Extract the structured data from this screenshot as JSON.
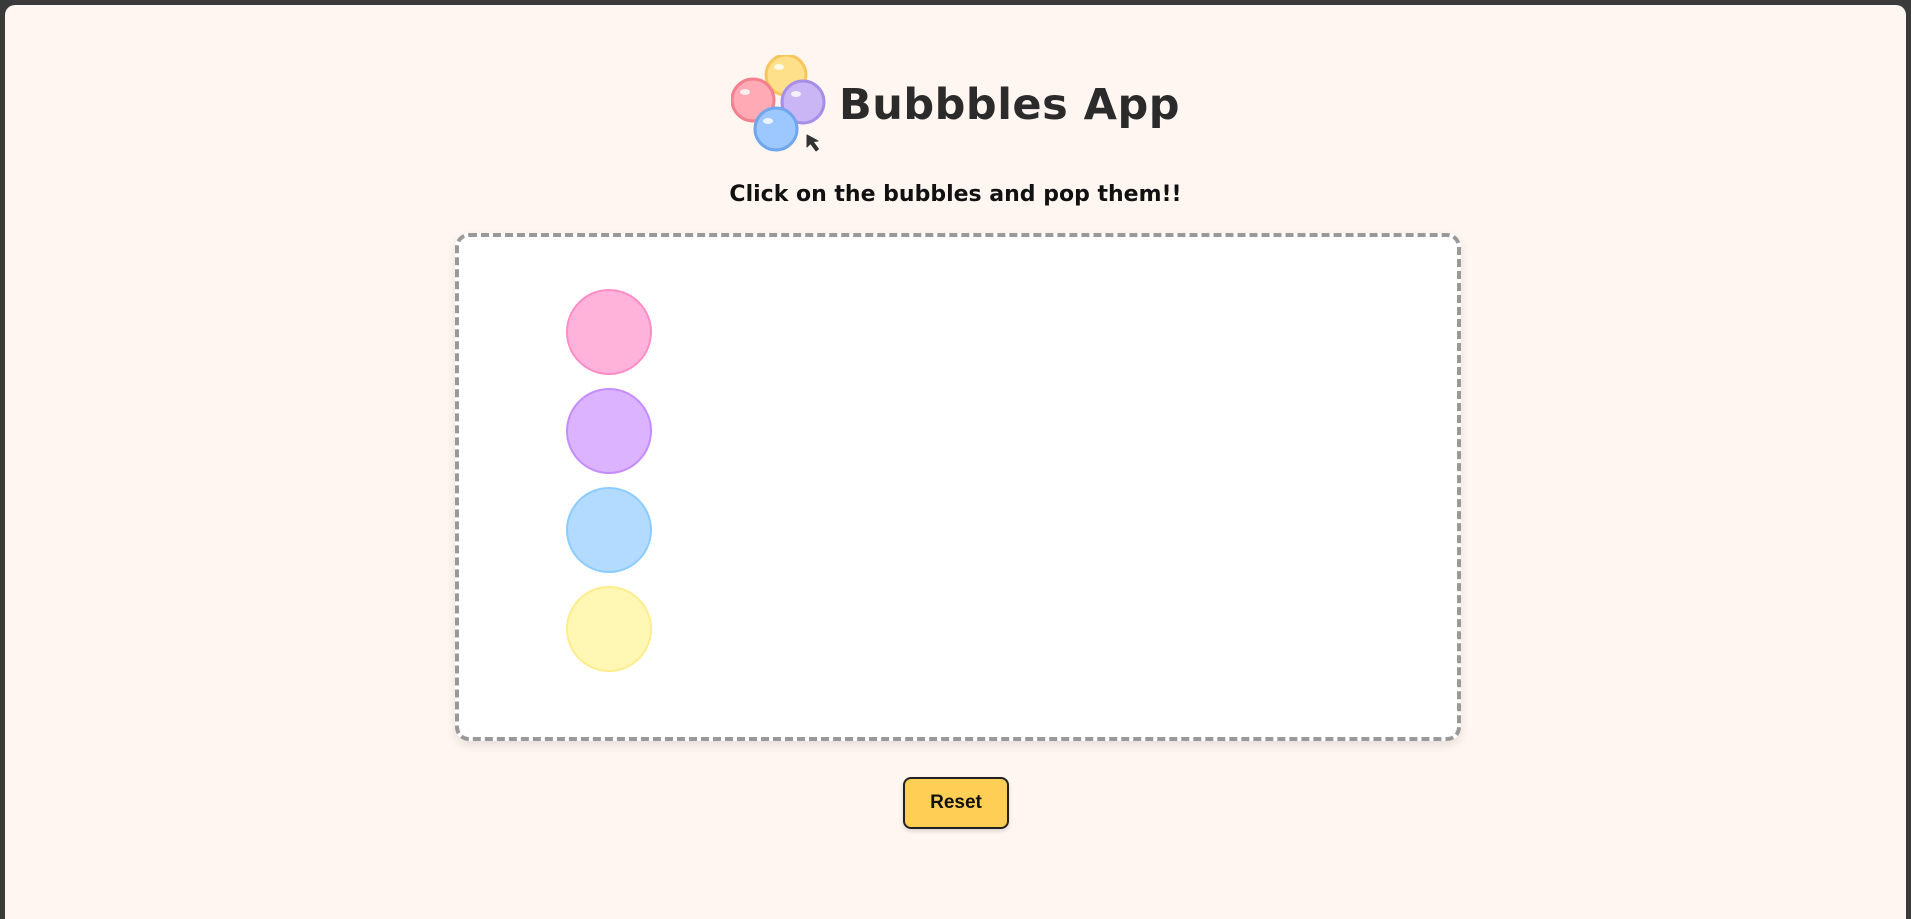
{
  "app": {
    "title": "Bubbbles App",
    "instruction": "Click on the bubbles and pop them!!"
  },
  "bubbles": [
    {
      "name": "pink",
      "fill": "#ffb3da",
      "border": "#ff8cc6"
    },
    {
      "name": "purple",
      "fill": "#dcb3ff",
      "border": "#c48cff"
    },
    {
      "name": "blue",
      "fill": "#b3dbff",
      "border": "#8cccff"
    },
    {
      "name": "yellow",
      "fill": "#fff7b3",
      "border": "#ffec8c"
    }
  ],
  "controls": {
    "reset_label": "Reset",
    "reset_color": "#ffcf55"
  },
  "icons": {
    "logo": "bubbles-logo-icon",
    "cursor": "cursor-arrow-icon"
  }
}
